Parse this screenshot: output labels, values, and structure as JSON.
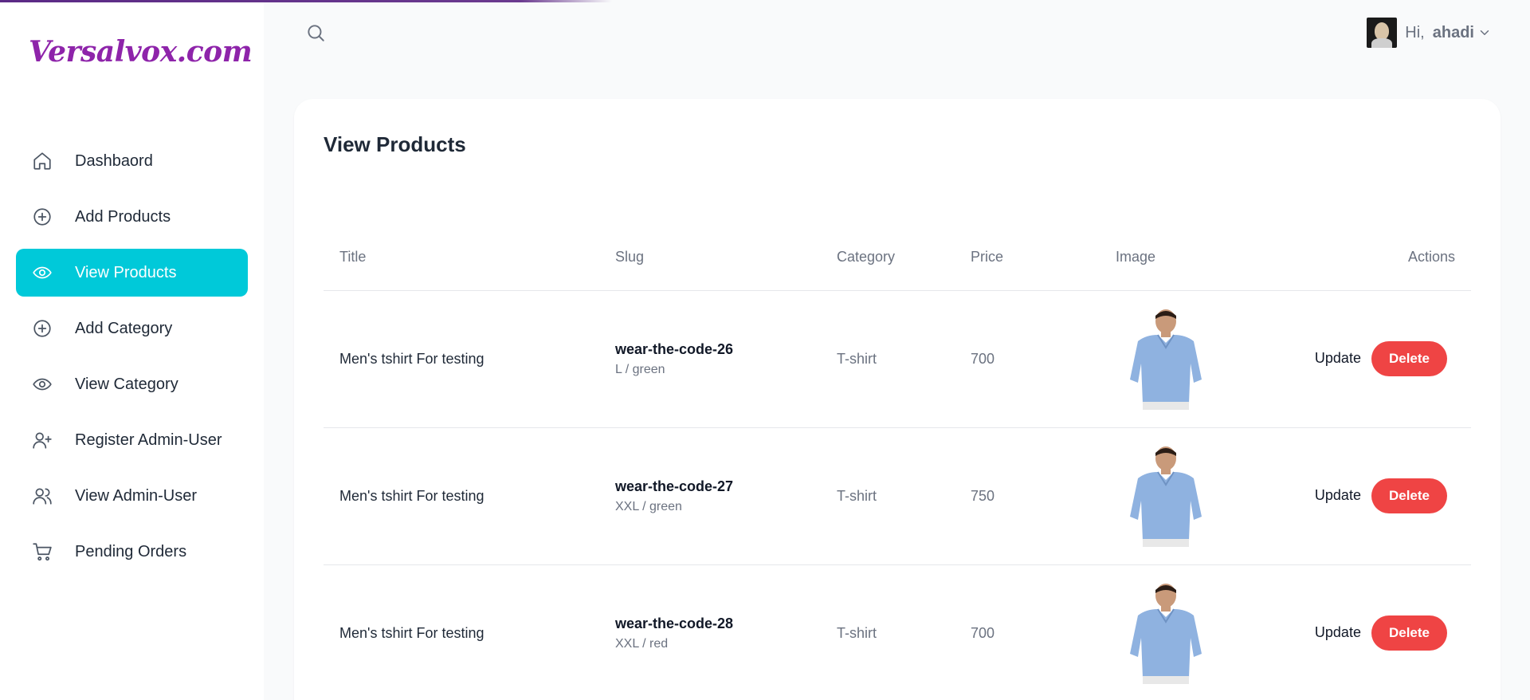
{
  "brand": {
    "logo_text": "Versalvox.com"
  },
  "sidebar": {
    "items": [
      {
        "label": "Dashbaord",
        "icon": "home-icon",
        "active": false
      },
      {
        "label": "Add Products",
        "icon": "plus-circle-icon",
        "active": false
      },
      {
        "label": "View Products",
        "icon": "eye-icon",
        "active": true
      },
      {
        "label": "Add Category",
        "icon": "plus-circle-icon",
        "active": false
      },
      {
        "label": "View Category",
        "icon": "eye-icon",
        "active": false
      },
      {
        "label": "Register Admin-User",
        "icon": "user-plus-icon",
        "active": false
      },
      {
        "label": "View Admin-User",
        "icon": "users-icon",
        "active": false
      },
      {
        "label": "Pending Orders",
        "icon": "cart-icon",
        "active": false
      }
    ]
  },
  "header": {
    "greeting": "Hi,",
    "username": "ahadi"
  },
  "main": {
    "title": "View Products",
    "columns": [
      "Title",
      "Slug",
      "Category",
      "Price",
      "Image",
      "Actions"
    ],
    "rows": [
      {
        "title": "Men's tshirt For testing",
        "slug": "wear-the-code-26",
        "variant": "L / green",
        "category": "T-shirt",
        "price": "700"
      },
      {
        "title": "Men's tshirt For testing",
        "slug": "wear-the-code-27",
        "variant": "XXL / green",
        "category": "T-shirt",
        "price": "750"
      },
      {
        "title": "Men's tshirt For testing",
        "slug": "wear-the-code-28",
        "variant": "XXL / red",
        "category": "T-shirt",
        "price": "700"
      }
    ],
    "update_label": "Update",
    "delete_label": "Delete"
  },
  "colors": {
    "accent": "#00c9d9",
    "danger": "#ef4444",
    "brand": "#8e24aa"
  }
}
